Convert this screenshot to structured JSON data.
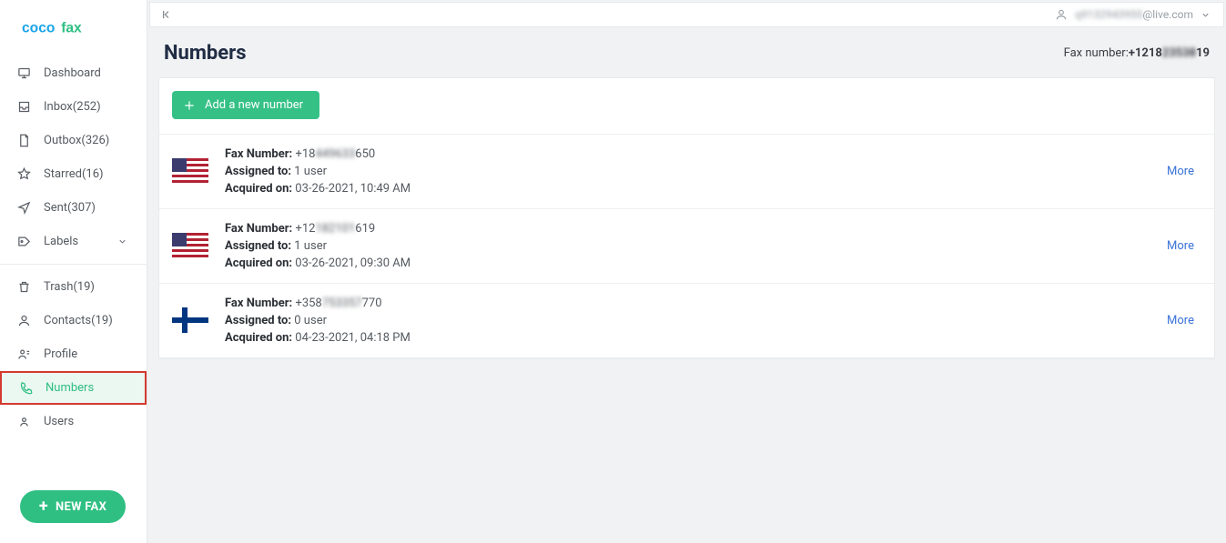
{
  "brand": {
    "name": "cocofax"
  },
  "topbar": {
    "user_masked_prefix": "q9132943955",
    "user_suffix": "@live.com"
  },
  "page": {
    "title": "Numbers",
    "fax_label": "Fax number:",
    "fax_prefix": "+1218",
    "fax_mid_masked": "23538",
    "fax_suffix": "19"
  },
  "sidebar": {
    "items": [
      {
        "label": "Dashboard"
      },
      {
        "label": "Inbox(252)"
      },
      {
        "label": "Outbox(326)"
      },
      {
        "label": "Starred(16)"
      },
      {
        "label": "Sent(307)"
      },
      {
        "label": "Labels",
        "has_chevron": true
      },
      {
        "label": "Trash(19)"
      },
      {
        "label": "Contacts(19)"
      },
      {
        "label": "Profile"
      },
      {
        "label": "Numbers",
        "active": true,
        "highlighted": true
      },
      {
        "label": "Users"
      }
    ],
    "new_fax_label": "NEW FAX"
  },
  "actions": {
    "add_number_label": "Add a new number"
  },
  "rows": [
    {
      "flag": "us",
      "fax_label": "Fax Number:",
      "fax_prefix": "+18",
      "fax_masked": "449633",
      "fax_suffix": "650",
      "assigned_label": "Assigned to:",
      "assigned_value": "1 user",
      "acquired_label": "Acquired on:",
      "acquired_value": "03-26-2021, 10:49 AM",
      "more": "More"
    },
    {
      "flag": "us",
      "fax_label": "Fax Number:",
      "fax_prefix": "+12",
      "fax_masked": "182101",
      "fax_suffix": "619",
      "assigned_label": "Assigned to:",
      "assigned_value": "1 user",
      "acquired_label": "Acquired on:",
      "acquired_value": "03-26-2021, 09:30 AM",
      "more": "More"
    },
    {
      "flag": "fi",
      "fax_label": "Fax Number:",
      "fax_prefix": "+358",
      "fax_masked": "753357",
      "fax_suffix": "770",
      "assigned_label": "Assigned to:",
      "assigned_value": "0 user",
      "acquired_label": "Acquired on:",
      "acquired_value": "04-23-2021, 04:18 PM",
      "more": "More"
    }
  ]
}
